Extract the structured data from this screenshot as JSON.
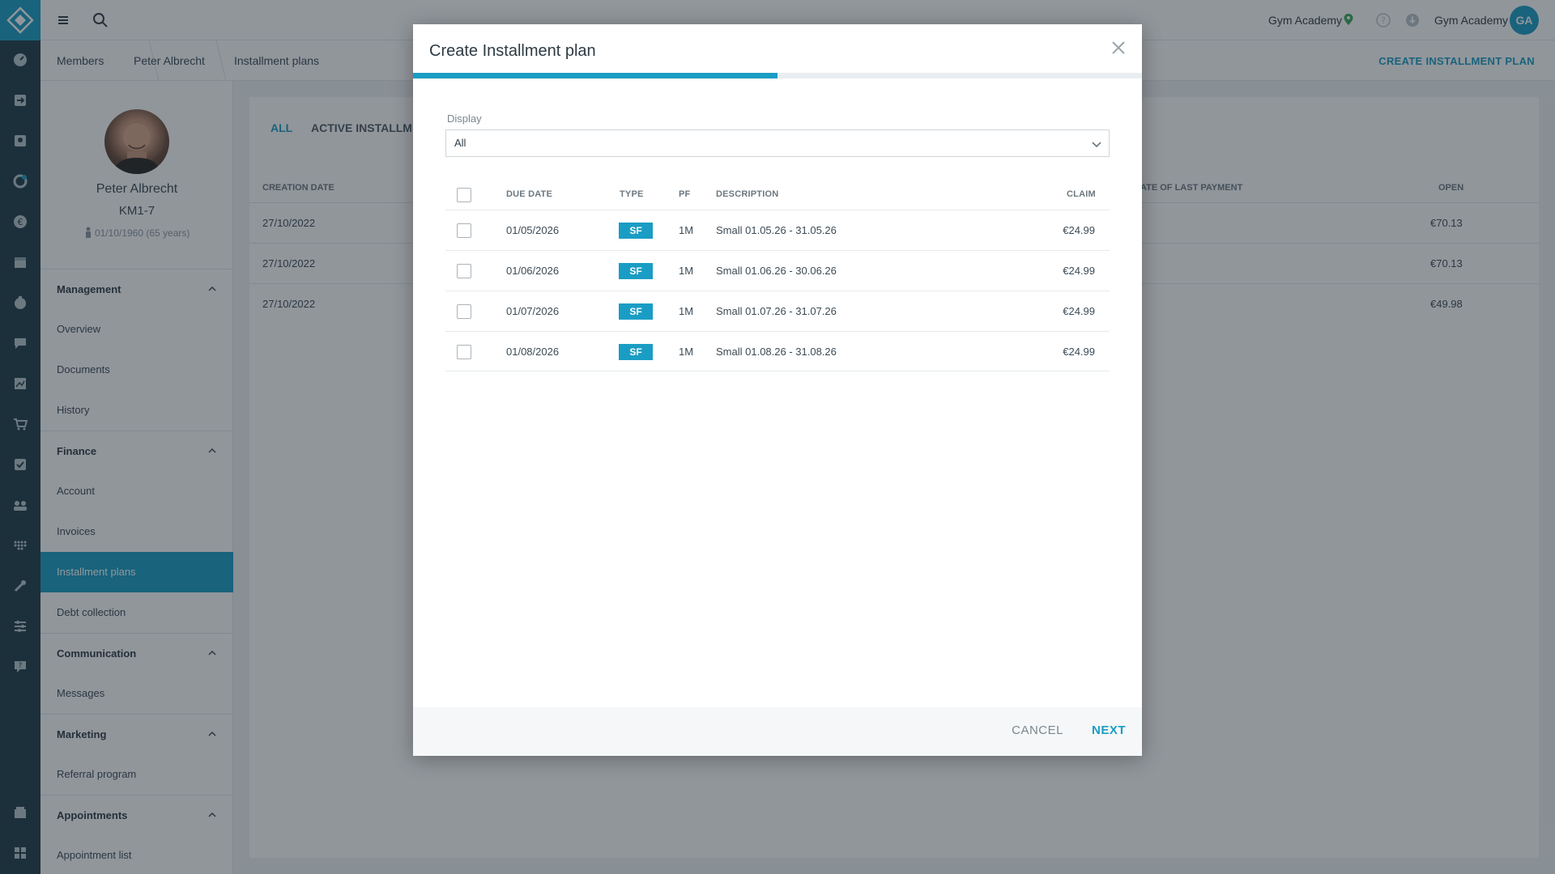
{
  "rail": {
    "icons": [
      "dashboard-icon",
      "checkin-icon",
      "members-icon",
      "leads-icon",
      "finance-icon",
      "calendar-icon",
      "courses-icon",
      "chat-icon",
      "reports-icon",
      "shop-icon",
      "tasks-icon",
      "groups-icon",
      "devices-icon",
      "tools-icon",
      "settings-icon",
      "support-icon",
      "store-icon",
      "apps-icon"
    ]
  },
  "topbar": {
    "studio": "Gym Academy",
    "user": "Gym Academy",
    "avatar_initials": "GA"
  },
  "breadcrumb": {
    "items": [
      "Members",
      "Peter Albrecht",
      "Installment plans"
    ],
    "action": "CREATE INSTALLMENT PLAN"
  },
  "member": {
    "name": "Peter Albrecht",
    "id": "KM1-7",
    "dob": "01/10/1960 (65 years)"
  },
  "sidebar": {
    "sections": [
      {
        "title": "Management",
        "items": [
          "Overview",
          "Documents",
          "History"
        ]
      },
      {
        "title": "Finance",
        "items": [
          "Account",
          "Invoices",
          "Installment plans",
          "Debt collection"
        ]
      },
      {
        "title": "Communication",
        "items": [
          "Messages"
        ]
      },
      {
        "title": "Marketing",
        "items": [
          "Referral program"
        ]
      },
      {
        "title": "Appointments",
        "items": [
          "Appointment list"
        ]
      }
    ],
    "active_item": "Installment plans"
  },
  "background": {
    "tabs": [
      "ALL",
      "ACTIVE INSTALLME"
    ],
    "headers": {
      "creation_date": "CREATION DATE",
      "last_payment": "ATE OF LAST PAYMENT",
      "open": "OPEN"
    },
    "rows": [
      {
        "creation_date": "27/10/2022",
        "open": "€70.13"
      },
      {
        "creation_date": "27/10/2022",
        "open": "€70.13"
      },
      {
        "creation_date": "27/10/2022",
        "open": "€49.98"
      }
    ]
  },
  "modal": {
    "title": "Create Installment plan",
    "progress": 0.5,
    "display_label": "Display",
    "display_value": "All",
    "headers": {
      "due_date": "DUE DATE",
      "type": "TYPE",
      "pf": "PF",
      "description": "DESCRIPTION",
      "claim": "CLAIM"
    },
    "rows": [
      {
        "due_date": "01/05/2026",
        "type": "SF",
        "pf": "1M",
        "description": "Small 01.05.26 - 31.05.26",
        "claim": "€24.99"
      },
      {
        "due_date": "01/06/2026",
        "type": "SF",
        "pf": "1M",
        "description": "Small 01.06.26 - 30.06.26",
        "claim": "€24.99"
      },
      {
        "due_date": "01/07/2026",
        "type": "SF",
        "pf": "1M",
        "description": "Small 01.07.26 - 31.07.26",
        "claim": "€24.99"
      },
      {
        "due_date": "01/08/2026",
        "type": "SF",
        "pf": "1M",
        "description": "Small 01.08.26 - 31.08.26",
        "claim": "€24.99"
      }
    ],
    "cancel_label": "CANCEL",
    "next_label": "NEXT"
  }
}
